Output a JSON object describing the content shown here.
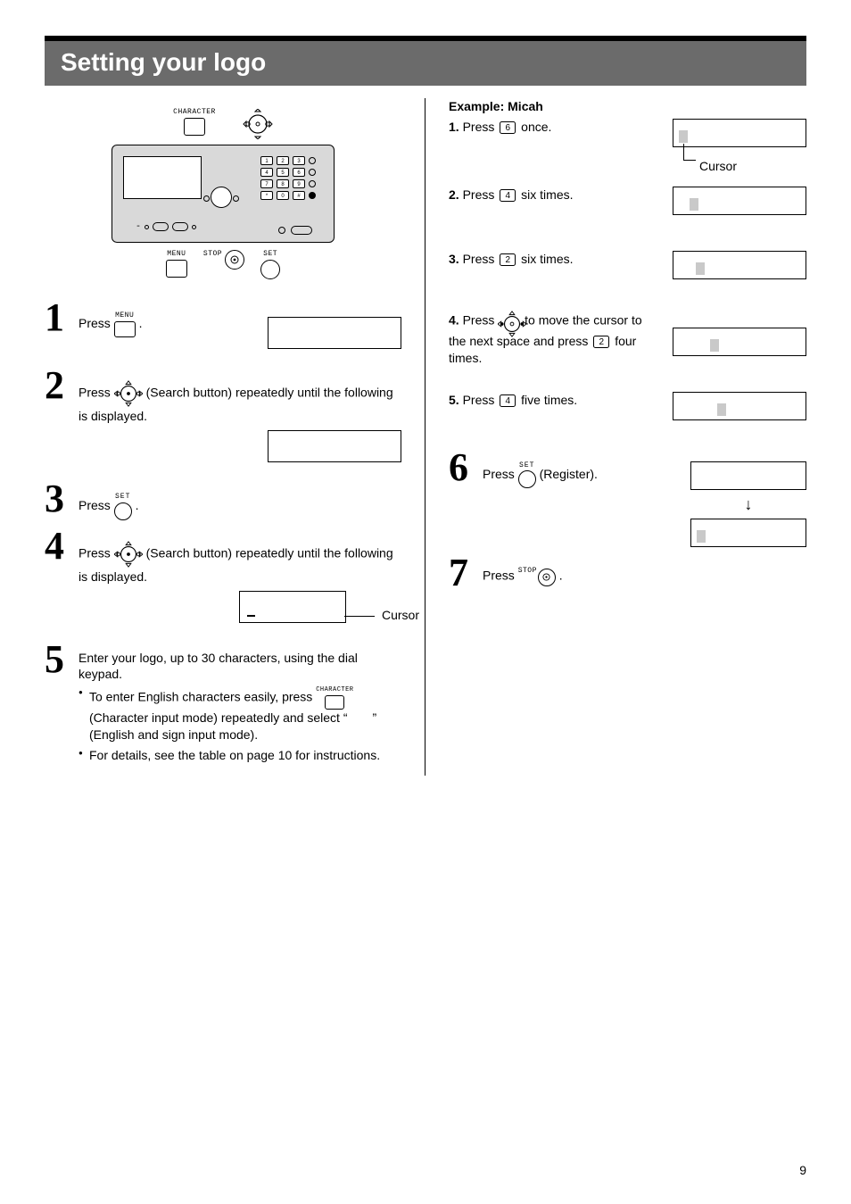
{
  "header": {
    "title": "Setting your logo"
  },
  "device": {
    "labels": {
      "character": "CHARACTER",
      "menu": "MENU",
      "stop": "STOP",
      "set": "SET"
    }
  },
  "left": {
    "step1": {
      "press": "Press",
      "label_menu": "MENU",
      "period": "."
    },
    "step2": {
      "text_a": "Press",
      "text_b": "(Search button) repeatedly until the following is displayed."
    },
    "step3": {
      "press": "Press",
      "label_set": "SET",
      "period": "."
    },
    "step4": {
      "text_a": "Press",
      "text_b": "(Search button) repeatedly until the following is displayed.",
      "cursor": "Cursor"
    },
    "step5": {
      "line1": "Enter your logo, up to 30 characters, using the dial keypad.",
      "label_character": "CHARACTER",
      "bullet1a": "To enter English characters easily, press",
      "bullet1b": "(Character input mode) repeatedly and select “　　” (English and sign input mode).",
      "bullet2": "For details, see the table on page 10 for instructions."
    }
  },
  "right": {
    "example_label": "Example: Micah",
    "s1": {
      "pre": "1.",
      "a": "Press",
      "key": "6",
      "b": "once."
    },
    "cursor_label": "Cursor",
    "s2": {
      "pre": "2.",
      "a": "Press",
      "key": "4",
      "b": "six times."
    },
    "s3": {
      "pre": "3.",
      "a": "Press",
      "key": "2",
      "b": "six times."
    },
    "s4": {
      "pre": "4.",
      "a": "Press",
      "b": "to move the cursor to the next space and press",
      "key": "2",
      "c": "four times."
    },
    "s5": {
      "pre": "5.",
      "a": "Press",
      "key": "4",
      "b": "five times."
    },
    "step6": {
      "press": "Press",
      "label_set": "SET",
      "b": "(Register)."
    },
    "step7": {
      "press": "Press",
      "label_stop": "STOP",
      "period": "."
    }
  },
  "page_number": "9"
}
